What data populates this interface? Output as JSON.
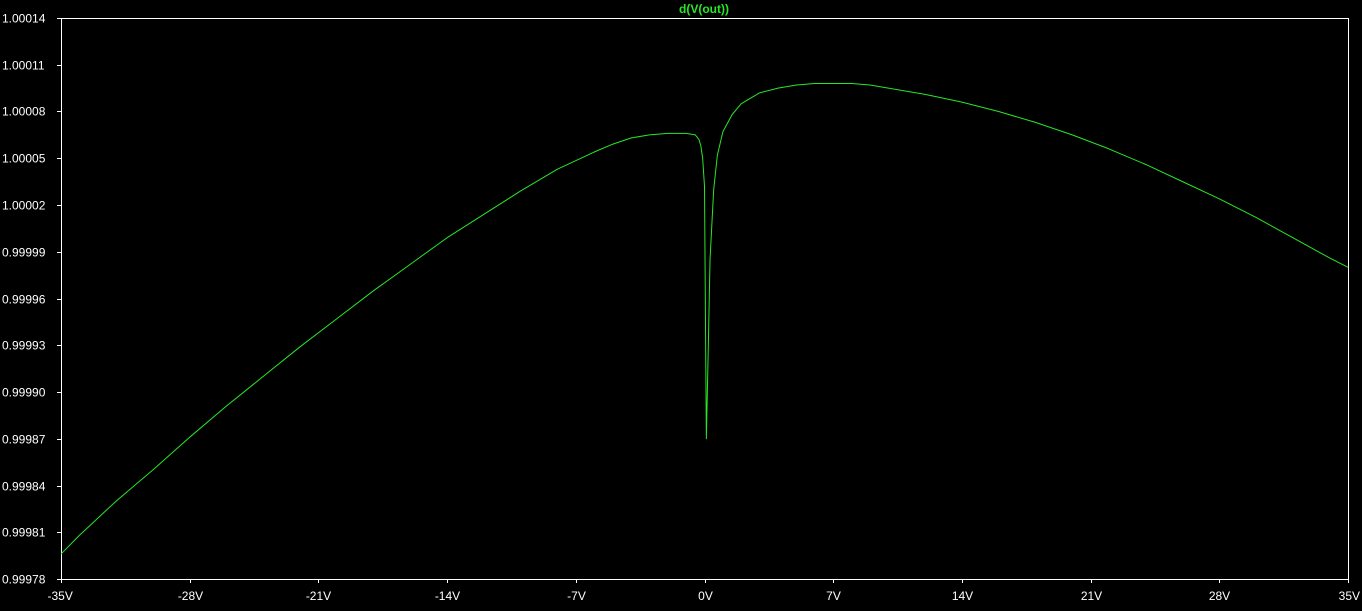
{
  "colors": {
    "background": "#000000",
    "axis": "#ffffff",
    "trace": "#27e627",
    "tick_text": "#ffffff"
  },
  "chart_data": {
    "type": "line",
    "title": "d(V(out))",
    "xlabel": "",
    "ylabel": "",
    "grid": false,
    "xlim": [
      -35,
      35
    ],
    "ylim": [
      0.99978,
      1.00014
    ],
    "x_ticks": [
      -35,
      -28,
      -21,
      -14,
      -7,
      0,
      7,
      14,
      21,
      28,
      35
    ],
    "x_tick_labels": [
      "-35V",
      "-28V",
      "-21V",
      "-14V",
      "-7V",
      "0V",
      "7V",
      "14V",
      "21V",
      "28V",
      "35V"
    ],
    "y_ticks": [
      0.99978,
      0.99981,
      0.99984,
      0.99987,
      0.9999,
      0.99993,
      0.99996,
      0.99999,
      1.00002,
      1.00005,
      1.00008,
      1.00011,
      1.00014
    ],
    "y_tick_labels": [
      "0.99978",
      "0.99981",
      "0.99984",
      "0.99987",
      "0.99990",
      "0.99993",
      "0.99996",
      "0.99999",
      "1.00002",
      "1.00005",
      "1.00008",
      "1.00011",
      "1.00014"
    ],
    "series": [
      {
        "name": "d(V(out))",
        "x": [
          -35,
          -34,
          -32,
          -30,
          -28,
          -26,
          -24,
          -22,
          -20,
          -18,
          -16,
          -14,
          -12,
          -10,
          -8,
          -6,
          -5,
          -4,
          -3,
          -2,
          -1,
          -0.5,
          -0.3,
          -0.2,
          -0.1,
          0,
          0.1,
          0.2,
          0.3,
          0.5,
          0.7,
          1,
          1.5,
          2,
          3,
          4,
          5,
          6,
          7,
          8,
          9,
          10,
          12,
          14,
          16,
          18,
          20,
          22,
          24,
          26,
          28,
          30,
          32,
          34,
          35
        ],
        "y": [
          0.999796,
          0.999808,
          0.99983,
          0.99985,
          0.999871,
          0.999891,
          0.99991,
          0.999929,
          0.999947,
          0.999965,
          0.999982,
          0.999999,
          1.000014,
          1.000029,
          1.000043,
          1.000054,
          1.000059,
          1.000063,
          1.000065,
          1.000066,
          1.000066,
          1.000065,
          1.000062,
          1.000058,
          1.00005,
          1.000032,
          0.99987,
          0.999925,
          0.999985,
          1.00003,
          1.000052,
          1.000067,
          1.000078,
          1.000085,
          1.000092,
          1.000095,
          1.000097,
          1.000098,
          1.000098,
          1.000098,
          1.000097,
          1.000095,
          1.000091,
          1.000086,
          1.00008,
          1.000073,
          1.000065,
          1.000056,
          1.000046,
          1.000035,
          1.000024,
          1.000012,
          0.999999,
          0.999986,
          0.99998
        ]
      }
    ]
  }
}
